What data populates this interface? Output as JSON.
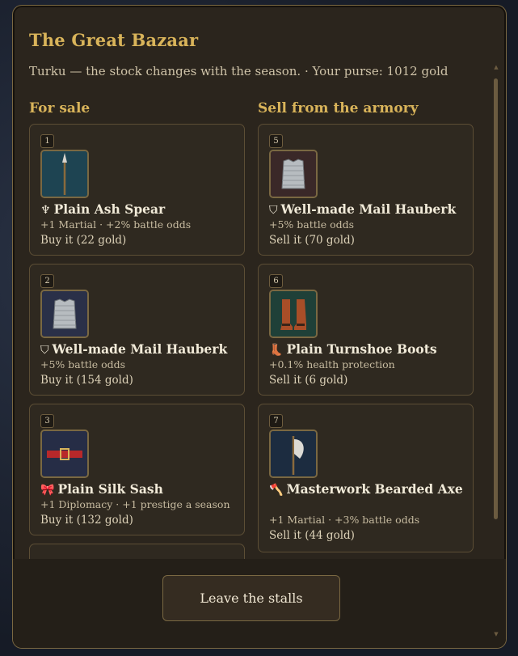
{
  "window": {
    "title": "The Great Bazaar",
    "subtitle": "Turku — the stock changes with the season. · Your purse: 1012 gold"
  },
  "columns": {
    "buy_heading": "For sale",
    "sell_heading": "Sell from the armory"
  },
  "buy_items": [
    {
      "number": "1",
      "icon": "♆",
      "icon_name": "trident-icon",
      "name": "Plain Ash Spear",
      "stats": "+1 Martial · +2% battle odds",
      "price": "Buy it (22 gold)",
      "thumb": "spear"
    },
    {
      "number": "2",
      "icon": "⛉",
      "icon_name": "shield-icon",
      "name": "Well-made Mail Hauberk",
      "stats": "+5% battle odds",
      "price": "Buy it (154 gold)",
      "thumb": "mail"
    },
    {
      "number": "3",
      "icon": "🎀",
      "icon_name": "ribbon-icon",
      "name": "Plain Silk Sash",
      "stats": "+1 Diplomacy · +1 prestige a season",
      "price": "Buy it (132 gold)",
      "thumb": "sash"
    }
  ],
  "sell_items": [
    {
      "number": "5",
      "icon": "⛉",
      "icon_name": "shield-icon",
      "name": "Well-made Mail Hauberk",
      "stats": "+5% battle odds",
      "price": "Sell it (70 gold)",
      "thumb": "mail"
    },
    {
      "number": "6",
      "icon": "👢",
      "icon_name": "boot-icon",
      "name": "Plain Turnshoe Boots",
      "stats": "+0.1% health protection",
      "price": "Sell it (6 gold)",
      "thumb": "boots"
    },
    {
      "number": "7",
      "icon": "🪓",
      "icon_name": "axe-icon",
      "name": "Masterwork Bearded Axe",
      "stats": "+1 Martial · +3% battle odds",
      "price": "Sell it (44 gold)",
      "thumb": "axe"
    }
  ],
  "footer": {
    "leave_label": "Leave the stalls"
  },
  "colors": {
    "accent_gold": "#d9b45a",
    "panel_bg": "#2b251d",
    "card_border": "#5c4e35"
  }
}
